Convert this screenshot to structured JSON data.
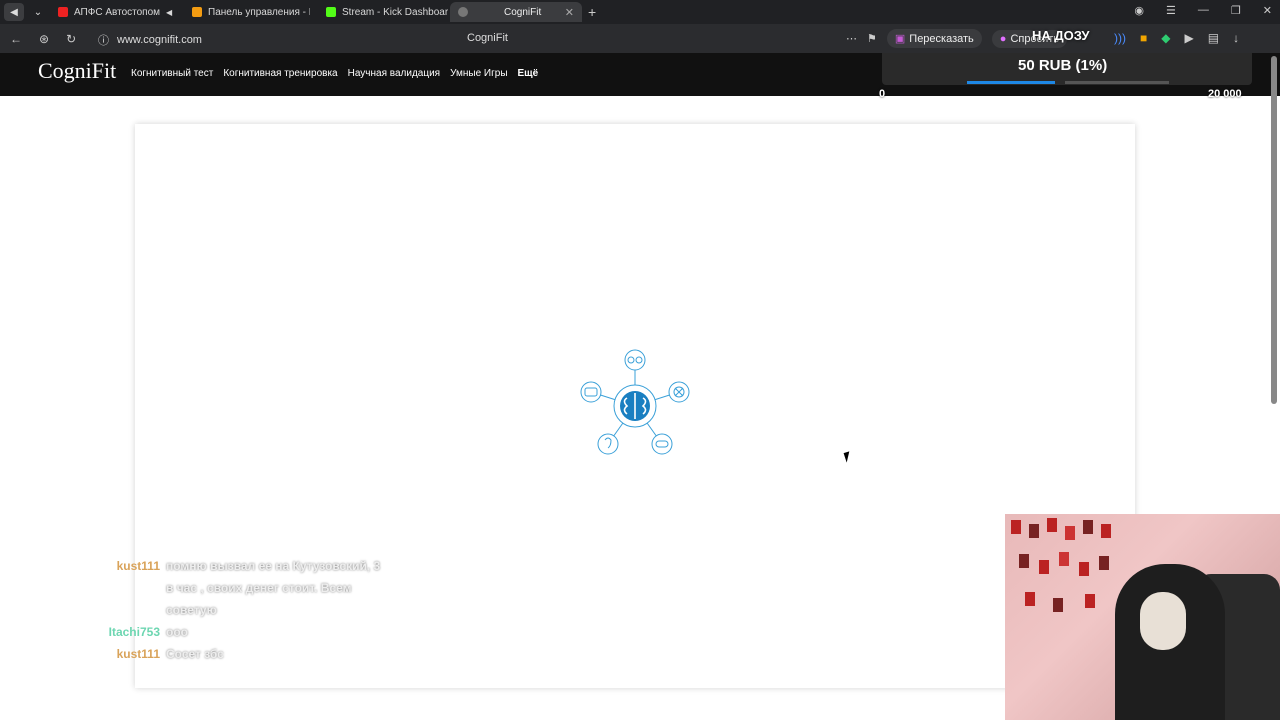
{
  "browser": {
    "tabs": [
      {
        "title": "АПФС Автостопом"
      },
      {
        "title": "Панель управления - Don"
      },
      {
        "title": "Stream - Kick Dashboard"
      },
      {
        "title": "CogniFit"
      }
    ],
    "url": "www.cognifit.com",
    "page_title": "CogniFit",
    "actions": {
      "retell": "Пересказать",
      "ask": "Спросить"
    }
  },
  "site": {
    "logo": "CogniFit",
    "menu": [
      "Когнитивный тест",
      "Когнитивная тренировка",
      "Научная валидация",
      "Умные Игры",
      "Ещё"
    ]
  },
  "donation": {
    "title": "НА ДОЗУ",
    "amount": "50 RUB (1%)",
    "min": "0",
    "max": "20 000",
    "progress_fraction": 0.01
  },
  "chat": [
    {
      "user": "kust111",
      "message": "помню вызвал ее на Кутузовский, 3 в час , своих денег стоит. Всем советую",
      "color": "#d9a35a"
    },
    {
      "user": "Itachi753",
      "message": "ооо",
      "color": "#6dd6b1"
    },
    {
      "user": "kust111",
      "message": "Сосет збс",
      "color": "#d9a35a"
    }
  ],
  "colors": {
    "brand_blue": "#3aa0d8",
    "header_bg": "#111111"
  }
}
